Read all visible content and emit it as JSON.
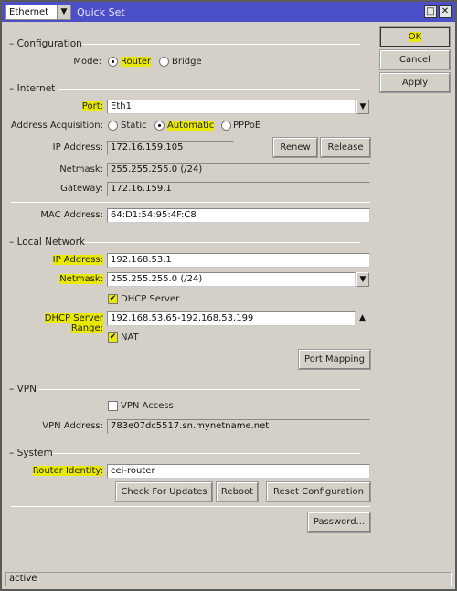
{
  "titlebar": {
    "interface_select": "Ethernet",
    "title": "Quick Set",
    "maximize_icon": "maximize-icon",
    "close_icon": "close-icon"
  },
  "actions": {
    "ok": "OK",
    "cancel": "Cancel",
    "apply": "Apply"
  },
  "configuration": {
    "title": "Configuration",
    "mode_label": "Mode:",
    "mode_options": [
      "Router",
      "Bridge"
    ],
    "mode_selected": "Router"
  },
  "internet": {
    "title": "Internet",
    "port_label": "Port:",
    "port_value": "Eth1",
    "acq_label": "Address Acquisition:",
    "acq_options": [
      "Static",
      "Automatic",
      "PPPoE"
    ],
    "acq_selected": "Automatic",
    "ip_label": "IP Address:",
    "ip_value": "172.16.159.105",
    "renew": "Renew",
    "release": "Release",
    "netmask_label": "Netmask:",
    "netmask_value": "255.255.255.0 (/24)",
    "gateway_label": "Gateway:",
    "gateway_value": "172.16.159.1",
    "mac_label": "MAC Address:",
    "mac_value": "64:D1:54:95:4F:C8"
  },
  "local": {
    "title": "Local Network",
    "ip_label": "IP Address:",
    "ip_value": "192.168.53.1",
    "netmask_label": "Netmask:",
    "netmask_value": "255.255.255.0 (/24)",
    "dhcp_label": "DHCP Server",
    "dhcp_checked": true,
    "range_label": "DHCP Server Range:",
    "range_value": "192.168.53.65-192.168.53.199",
    "nat_label": "NAT",
    "nat_checked": true,
    "port_mapping": "Port Mapping"
  },
  "vpn": {
    "title": "VPN",
    "access_label": "VPN Access",
    "access_checked": false,
    "address_label": "VPN Address:",
    "address_value": "783e07dc5517.sn.mynetname.net"
  },
  "system": {
    "title": "System",
    "identity_label": "Router Identity:",
    "identity_value": "cei-router",
    "check_updates": "Check For Updates",
    "reboot": "Reboot",
    "reset": "Reset Configuration",
    "password": "Password..."
  },
  "status": "active"
}
